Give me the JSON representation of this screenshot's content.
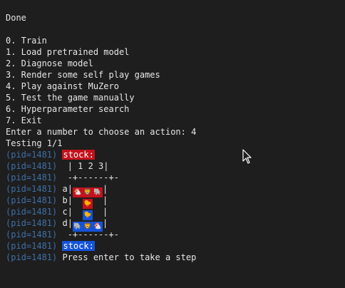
{
  "header": {
    "done_text": "Done"
  },
  "menu": [
    "0. Train",
    "1. Load pretrained model",
    "2. Diagnose model",
    "3. Render some self play games",
    "4. Play against MuZero",
    "5. Test the game manually",
    "6. Hyperparameter search",
    "7. Exit"
  ],
  "prompt": {
    "text": "Enter a number to choose an action: 4"
  },
  "testing": {
    "text": "Testing 1/1"
  },
  "pid_label": "(pid=1481)",
  "stock_label": "stock:",
  "board": {
    "header_row": " | 1 2 3|",
    "border_row": " -+------+-",
    "rows": [
      {
        "label": "a|",
        "end": "|",
        "cells": [
          {
            "color": "red",
            "glyph": "🐔"
          },
          {
            "color": "red",
            "glyph": "🦁"
          },
          {
            "color": "red",
            "glyph": "🐘"
          }
        ]
      },
      {
        "label": "b|",
        "end": "|",
        "cells": [
          {
            "color": "empty",
            "glyph": ""
          },
          {
            "color": "red",
            "glyph": "🐤"
          },
          {
            "color": "empty",
            "glyph": ""
          }
        ]
      },
      {
        "label": "c|",
        "end": "|",
        "cells": [
          {
            "color": "empty",
            "glyph": ""
          },
          {
            "color": "blue",
            "glyph": "🐤"
          },
          {
            "color": "empty",
            "glyph": ""
          }
        ]
      },
      {
        "label": "d|",
        "end": "|",
        "cells": [
          {
            "color": "blue",
            "glyph": "🐘"
          },
          {
            "color": "blue",
            "glyph": "🦁"
          },
          {
            "color": "blue",
            "glyph": "🐔"
          }
        ]
      }
    ]
  },
  "footer": {
    "press_enter": "Press enter to take a step"
  },
  "colors": {
    "background": "#1e1e1e",
    "pid": "#3f6fa8",
    "stock_red": "#c3121c",
    "stock_blue": "#1453d8",
    "text": "#e6e6e6"
  },
  "cursor": {
    "icon": "mouse-pointer-icon"
  }
}
